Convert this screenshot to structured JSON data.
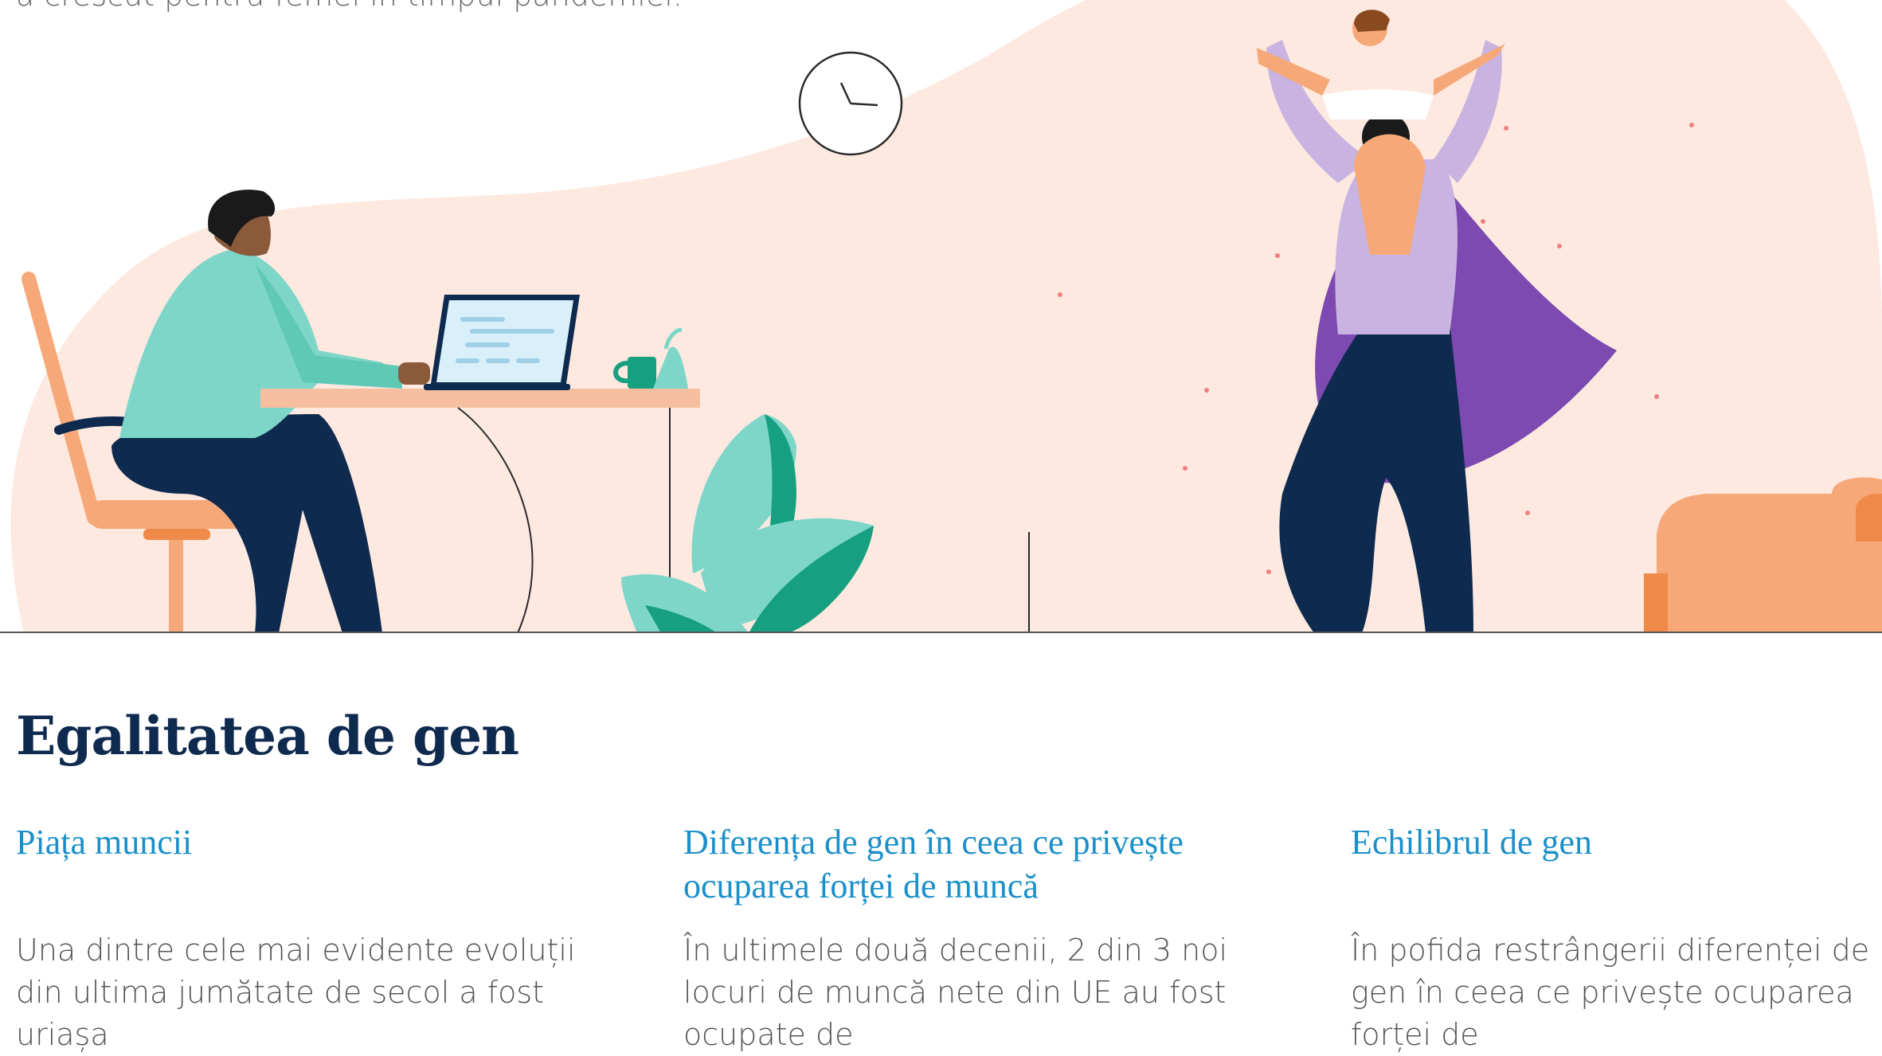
{
  "hero": {
    "intro_text": "a crescut pentru femei în timpul pandemiei.",
    "colors": {
      "blob": "#fde9e0",
      "teal": "#7dd6c8",
      "navy": "#0f2a4f",
      "peach": "#f6a878",
      "lavender": "#c9b3e0",
      "purple": "#7c4ab0",
      "green": "#17a07f"
    }
  },
  "section": {
    "title": "Egalitatea de gen"
  },
  "columns": [
    {
      "heading": "Piața muncii",
      "body": "Una dintre cele mai evidente evoluții din ultima jumătate de secol a fost uriașa"
    },
    {
      "heading": "Diferența de gen în ceea ce privește ocuparea forței de muncă",
      "body": "În ultimele două decenii, 2 din 3 noi locuri de muncă nete din UE au fost ocupate de"
    },
    {
      "heading": "Echilibrul de gen",
      "body": "În pofida restrângerii diferenței de gen în ceea ce privește ocuparea forței de"
    }
  ]
}
